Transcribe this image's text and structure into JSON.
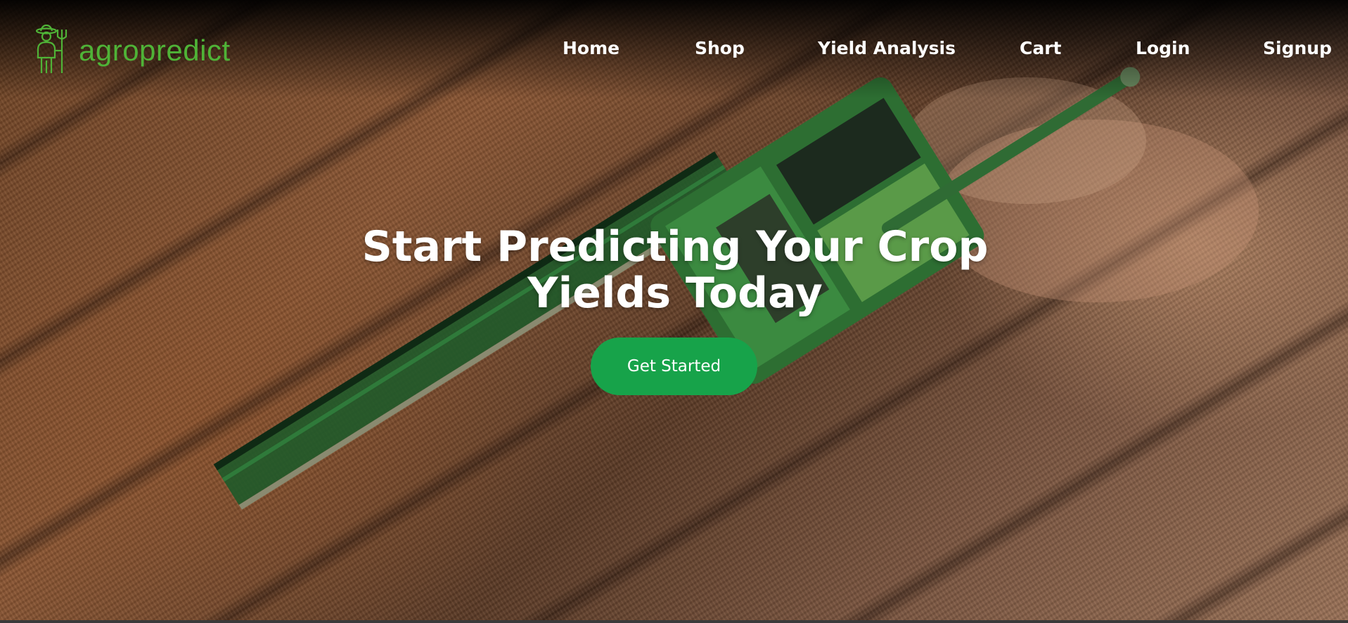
{
  "brand": {
    "name": "agropredict",
    "icon": "farmer-icon",
    "color": "#4fb337"
  },
  "nav": {
    "items": [
      {
        "label": "Home"
      },
      {
        "label": "Shop"
      },
      {
        "label": "Yield Analysis"
      },
      {
        "label": "Cart"
      },
      {
        "label": "Login"
      },
      {
        "label": "Signup"
      }
    ]
  },
  "hero": {
    "headline_line1": "Start Predicting Your Crop",
    "headline_line2": "Yields Today",
    "cta_label": "Get Started",
    "cta_color": "#17a34a",
    "background": "aerial-harvester-field-image"
  }
}
